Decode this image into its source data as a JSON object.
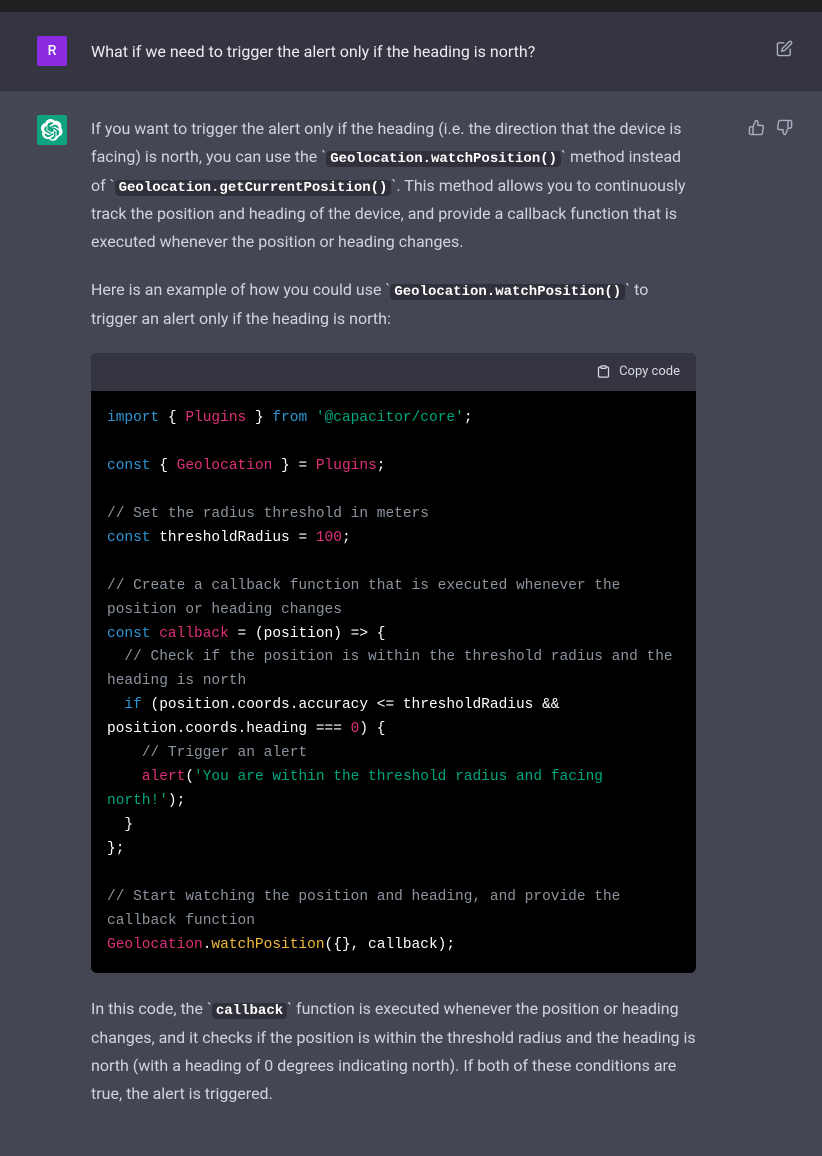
{
  "user": {
    "avatar_letter": "R",
    "message": "What if we need to trigger the alert only if the heading is north?"
  },
  "assistant": {
    "para1_a": "If you want to trigger the alert only if the heading (i.e. the direction that the device is facing) is north, you can use the ",
    "code1": "Geolocation.watchPosition()",
    "para1_b": " method instead of ",
    "code2": "Geolocation.getCurrentPosition()",
    "para1_c": ". This method allows you to continuously track the position and heading of the device, and provide a callback function that is executed whenever the position or heading changes.",
    "para2_a": "Here is an example of how you could use ",
    "code3": "Geolocation.watchPosition()",
    "para2_b": " to trigger an alert only if the heading is north:",
    "para3_a": "In this code, the ",
    "code4": "callback",
    "para3_b": " function is executed whenever the position or heading changes, and it checks if the position is within the threshold radius and the heading is north (with a heading of 0 degrees indicating north). If both of these conditions are true, the alert is triggered."
  },
  "code": {
    "copy_label": "Copy code",
    "tokens": {
      "import": "import",
      "from": "from",
      "const": "const",
      "if": "if",
      "lbrace": "{",
      "rbrace": "}",
      "Plugins": "Plugins",
      "capacitor_core": "'@capacitor/core'",
      "semi": ";",
      "Geolocation": "Geolocation",
      "eq": " = ",
      "destructure_eq": " = ",
      "comment1": "// Set the radius threshold in meters",
      "thresholdRadius_decl": "thresholdRadius = ",
      "hundred": "100",
      "comment2": "// Create a callback function that is executed whenever the position or heading changes",
      "callback": "callback",
      "arrow_sig": " = (position) => {",
      "comment3": "  // Check if the position is within the threshold radius and the heading is north",
      "if_cond": " (position.coords.accuracy <= thresholdRadius && position.coords.heading === ",
      "zero": "0",
      "cond_close": ") {",
      "comment4": "    // Trigger an alert",
      "alert": "alert",
      "alert_open": "(",
      "alert_str": "'You are within the threshold radius and facing north!'",
      "alert_close": ");",
      "close_if": "  }",
      "close_cb": "};",
      "comment5": "// Start watching the position and heading, and provide the callback function",
      "Geolocation2": "Geolocation",
      "dot": ".",
      "watchPosition": "watchPosition",
      "call_args": "({}, callback);"
    }
  }
}
